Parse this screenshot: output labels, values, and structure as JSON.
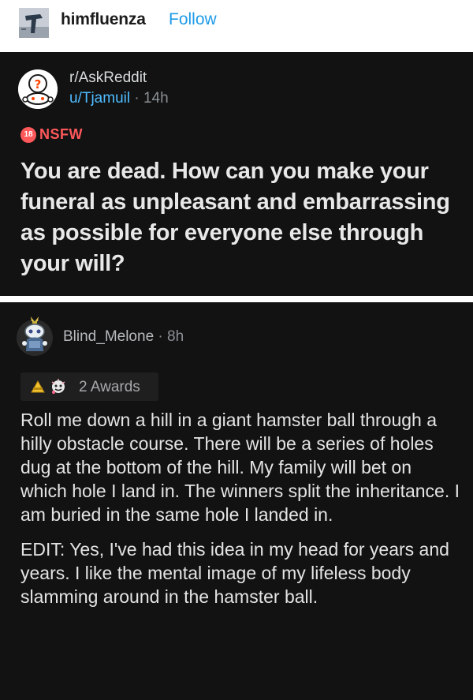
{
  "tumblr": {
    "username": "himfluenza",
    "follow_label": "Follow"
  },
  "post": {
    "subreddit": "r/AskReddit",
    "author": "u/Tjamuil",
    "separator": "·",
    "age": "14h",
    "nsfw_badge": "18",
    "nsfw_label": "NSFW",
    "title": "You are dead. How can you make your funeral as unpleasant and embarrassing as possible for everyone else through your will?"
  },
  "comment": {
    "author": "Blind_Melone",
    "separator": "·",
    "age": "8h",
    "awards_label": "2 Awards",
    "paragraphs": [
      "Roll me down a hill in a giant hamster ball through a hilly obstacle course. There will be a series of holes dug at the bottom of the hill. My family will bet on which hole I land in. The winners split the inheritance. I am buried in the same hole I landed in.",
      "EDIT: Yes, I've had this idea in my head for years and years. I like the mental image of my lifeless body slamming around in the hamster ball."
    ]
  },
  "colors": {
    "panel_bg": "#121212",
    "link_blue": "#4fbcff",
    "follow_blue": "#1e9be6",
    "nsfw_red": "#ff585b"
  },
  "icons": {
    "tumblr_avatar": "blog-avatar-icon",
    "subreddit_avatar": "askreddit-snoo-icon",
    "commenter_avatar": "snoo-avatar-icon",
    "award_1": "gold-award-icon",
    "award_2": "wholesome-award-icon"
  }
}
